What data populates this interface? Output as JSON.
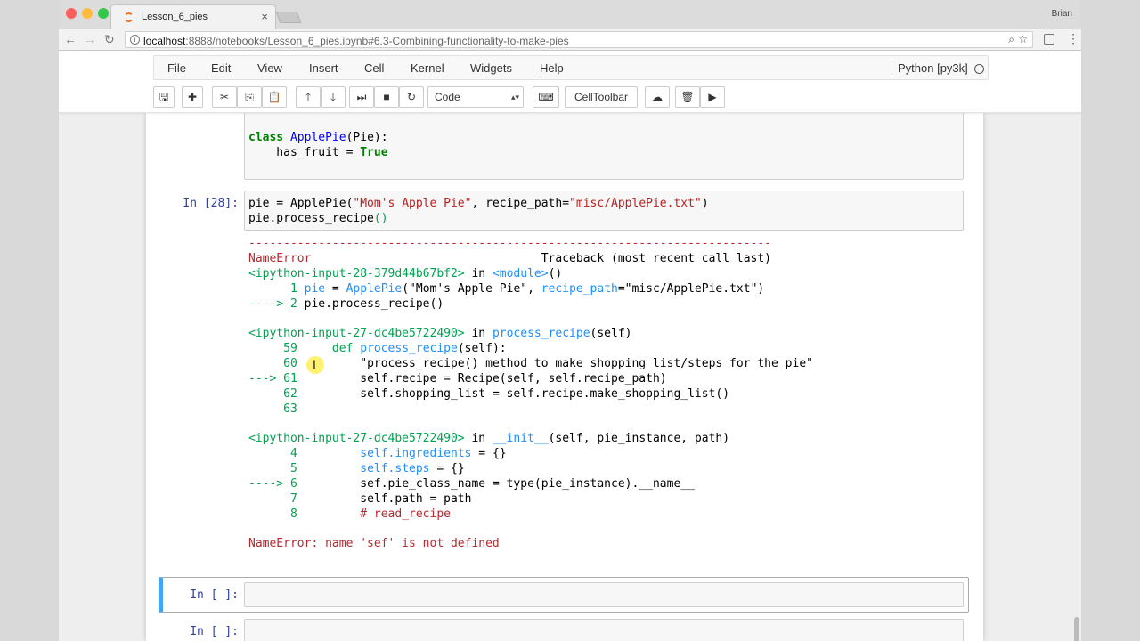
{
  "browser": {
    "tab_title": "Lesson_6_pies",
    "tab_close": "×",
    "user_name": "Brian",
    "url_host": "localhost",
    "url_path": ":8888/notebooks/Lesson_6_pies.ipynb#6.3-Combining-functionality-to-make-pies",
    "back": "←",
    "forward": "→",
    "reload": "↻",
    "zoom_icon": "⌕",
    "star_icon": "☆",
    "menu_icon": "⋮"
  },
  "menubar": {
    "items": [
      "File",
      "Edit",
      "View",
      "Insert",
      "Cell",
      "Kernel",
      "Widgets",
      "Help"
    ],
    "kernel_name": "Python [py3k]"
  },
  "toolbar": {
    "save": "🖫",
    "add": "✚",
    "cut": "✂",
    "copy": "⎘",
    "paste": "📋",
    "up": "🡑",
    "down": "🡓",
    "run": "⏭",
    "stop": "■",
    "restart": "↻",
    "cell_type": "Code",
    "cell_type_arrow": "▴▾",
    "keyboard": "⌨",
    "celltoolbar": "CellToolbar",
    "upload": "☁",
    "trash": "🗑",
    "video": "▶"
  },
  "cells": {
    "cell0_line1_kw": "class",
    "cell0_line1_name": "ApplePie",
    "cell0_line1_rest": "(Pie):",
    "cell0_line2_a": "    has_fruit = ",
    "cell0_line2_b": "True",
    "cell1_prompt": "In [28]:",
    "cell1_line1": "pie = ApplePie(",
    "cell1_str1": "\"Mom's Apple Pie\"",
    "cell1_mid": ", recipe_path=",
    "cell1_str2": "\"misc/ApplePie.txt\"",
    "cell1_end": ")",
    "cell1_line2": "pie.process_recipe",
    "cell1_line2_paren": "()",
    "empty_prompt": "In [ ]:"
  },
  "traceback": {
    "rule": "---------------------------------------------------------------------------",
    "error_name": "NameError",
    "header_right": "                                 Traceback (most recent call last)",
    "frame1_file": "<ipython-input-28-379d44b67bf2>",
    "frame1_in": " in ",
    "frame1_func": "<module>",
    "frame1_tail": "()",
    "f1_l1_num": "      1 ",
    "f1_l1_a": "pie",
    "f1_l1_b": " = ",
    "f1_l1_c": "ApplePie",
    "f1_l1_d": "(\"Mom's Apple Pie\", ",
    "f1_l1_e": "recipe_path",
    "f1_l1_f": "=\"misc/ApplePie.txt\")",
    "f1_l2_arrow": "----> 2 ",
    "f1_l2_code": "pie.process_recipe()",
    "frame2_file": "<ipython-input-27-dc4be5722490>",
    "frame2_in": " in ",
    "frame2_func": "process_recipe",
    "frame2_tail": "(self)",
    "f2_l59_num": "     59 ",
    "f2_l59_code_a": "    def ",
    "f2_l59_code_b": "process_recipe",
    "f2_l59_code_c": "(self):",
    "f2_l60_num": "     60 ",
    "f2_l60_code": "        \"process_recipe() method to make shopping list/steps for the pie\"",
    "f2_l61_arrow": "---> 61 ",
    "f2_l61_code": "        self.recipe = Recipe(self, self.recipe_path)",
    "f2_l62_num": "     62 ",
    "f2_l62_code": "        self.shopping_list = self.recipe.make_shopping_list()",
    "f2_l63_num": "     63 ",
    "frame3_file": "<ipython-input-27-dc4be5722490>",
    "frame3_in": " in ",
    "frame3_func": "__init__",
    "frame3_tail": "(self, pie_instance, path)",
    "f3_l4_num": "      4 ",
    "f3_l4_code_a": "        self.",
    "f3_l4_code_b": "ingredients",
    "f3_l4_code_c": " = {}",
    "f3_l5_num": "      5 ",
    "f3_l5_code_a": "        self.",
    "f3_l5_code_b": "steps",
    "f3_l5_code_c": " = {}",
    "f3_l6_arrow": "----> 6 ",
    "f3_l6_code": "        sef.pie_class_name = type(pie_instance).__name__",
    "f3_l7_num": "      7 ",
    "f3_l7_code": "        self.path = path",
    "f3_l8_num": "      8 ",
    "f3_l8_code": "        # read_recipe",
    "final_error": "NameError: name 'sef' is not defined"
  },
  "cursor_glyph": "I",
  "colors": {
    "prompt": "#303f9f",
    "traceback_red": "#b22b31",
    "traceback_green": "#00a250",
    "traceback_cyan": "#208ffb",
    "selected_cell_bar": "#42a5f5"
  }
}
